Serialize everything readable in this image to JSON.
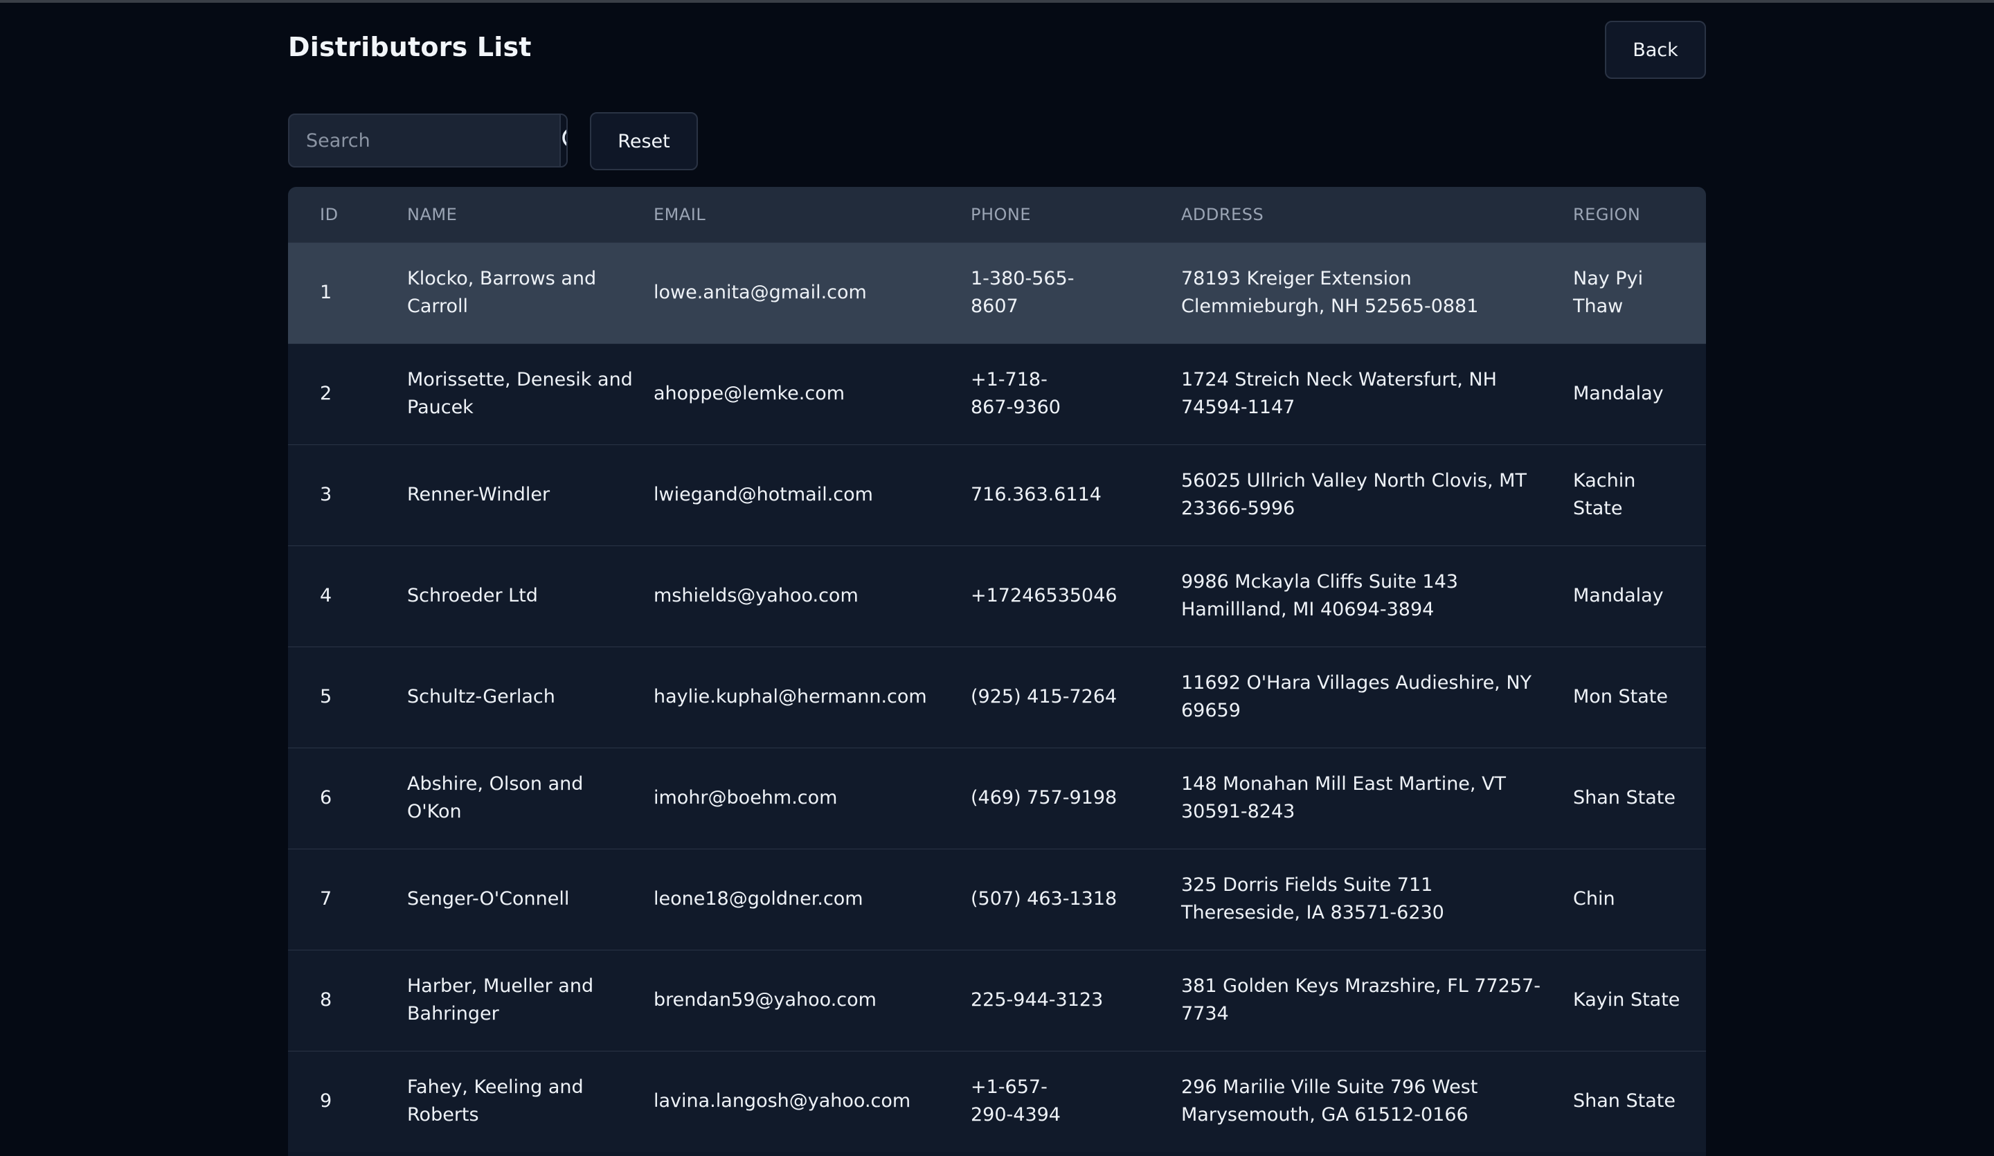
{
  "page": {
    "title": "Distributors List",
    "back_label": "Back",
    "reset_label": "Reset"
  },
  "search": {
    "placeholder": "Search",
    "value": ""
  },
  "icons": {
    "search": "search-icon"
  },
  "colors": {
    "background": "#050a14",
    "table_header": "#222c3c",
    "row_bg": "#111a2a",
    "row_highlight": "#354152"
  },
  "table": {
    "columns": [
      "ID",
      "NAME",
      "EMAIL",
      "PHONE",
      "ADDRESS",
      "REGION"
    ],
    "rows": [
      {
        "id": "1",
        "name": "Klocko, Barrows and Carroll",
        "email": "lowe.anita@gmail.com",
        "phone": "1-380-565-8607",
        "address": "78193 Kreiger Extension Clemmieburgh, NH 52565-0881",
        "region": "Nay Pyi Thaw"
      },
      {
        "id": "2",
        "name": "Morissette, Denesik and Paucek",
        "email": "ahoppe@lemke.com",
        "phone": "+1-718-867-9360",
        "address": "1724 Streich Neck Watersfurt, NH 74594-1147",
        "region": "Mandalay"
      },
      {
        "id": "3",
        "name": "Renner-Windler",
        "email": "lwiegand@hotmail.com",
        "phone": "716.363.6114",
        "address": "56025 Ullrich Valley North Clovis, MT 23366-5996",
        "region": "Kachin State"
      },
      {
        "id": "4",
        "name": "Schroeder Ltd",
        "email": "mshields@yahoo.com",
        "phone": "+17246535046",
        "address": "9986 Mckayla Cliffs Suite 143 Hamillland, MI 40694-3894",
        "region": "Mandalay"
      },
      {
        "id": "5",
        "name": "Schultz-Gerlach",
        "email": "haylie.kuphal@hermann.com",
        "phone": "(925) 415-7264",
        "address": "11692 O'Hara Villages Audieshire, NY 69659",
        "region": "Mon State"
      },
      {
        "id": "6",
        "name": "Abshire, Olson and O'Kon",
        "email": "imohr@boehm.com",
        "phone": "(469) 757-9198",
        "address": "148 Monahan Mill East Martine, VT 30591-8243",
        "region": "Shan State"
      },
      {
        "id": "7",
        "name": "Senger-O'Connell",
        "email": "leone18@goldner.com",
        "phone": "(507) 463-1318",
        "address": "325 Dorris Fields Suite 711 Thereseside, IA 83571-6230",
        "region": "Chin"
      },
      {
        "id": "8",
        "name": "Harber, Mueller and Bahringer",
        "email": "brendan59@yahoo.com",
        "phone": "225-944-3123",
        "address": "381 Golden Keys Mrazshire, FL 77257-7734",
        "region": "Kayin State"
      },
      {
        "id": "9",
        "name": "Fahey, Keeling and Roberts",
        "email": "lavina.langosh@yahoo.com",
        "phone": "+1-657-290-4394",
        "address": "296 Marilie Ville Suite 796 West Marysemouth, GA 61512-0166",
        "region": "Shan State"
      }
    ]
  }
}
